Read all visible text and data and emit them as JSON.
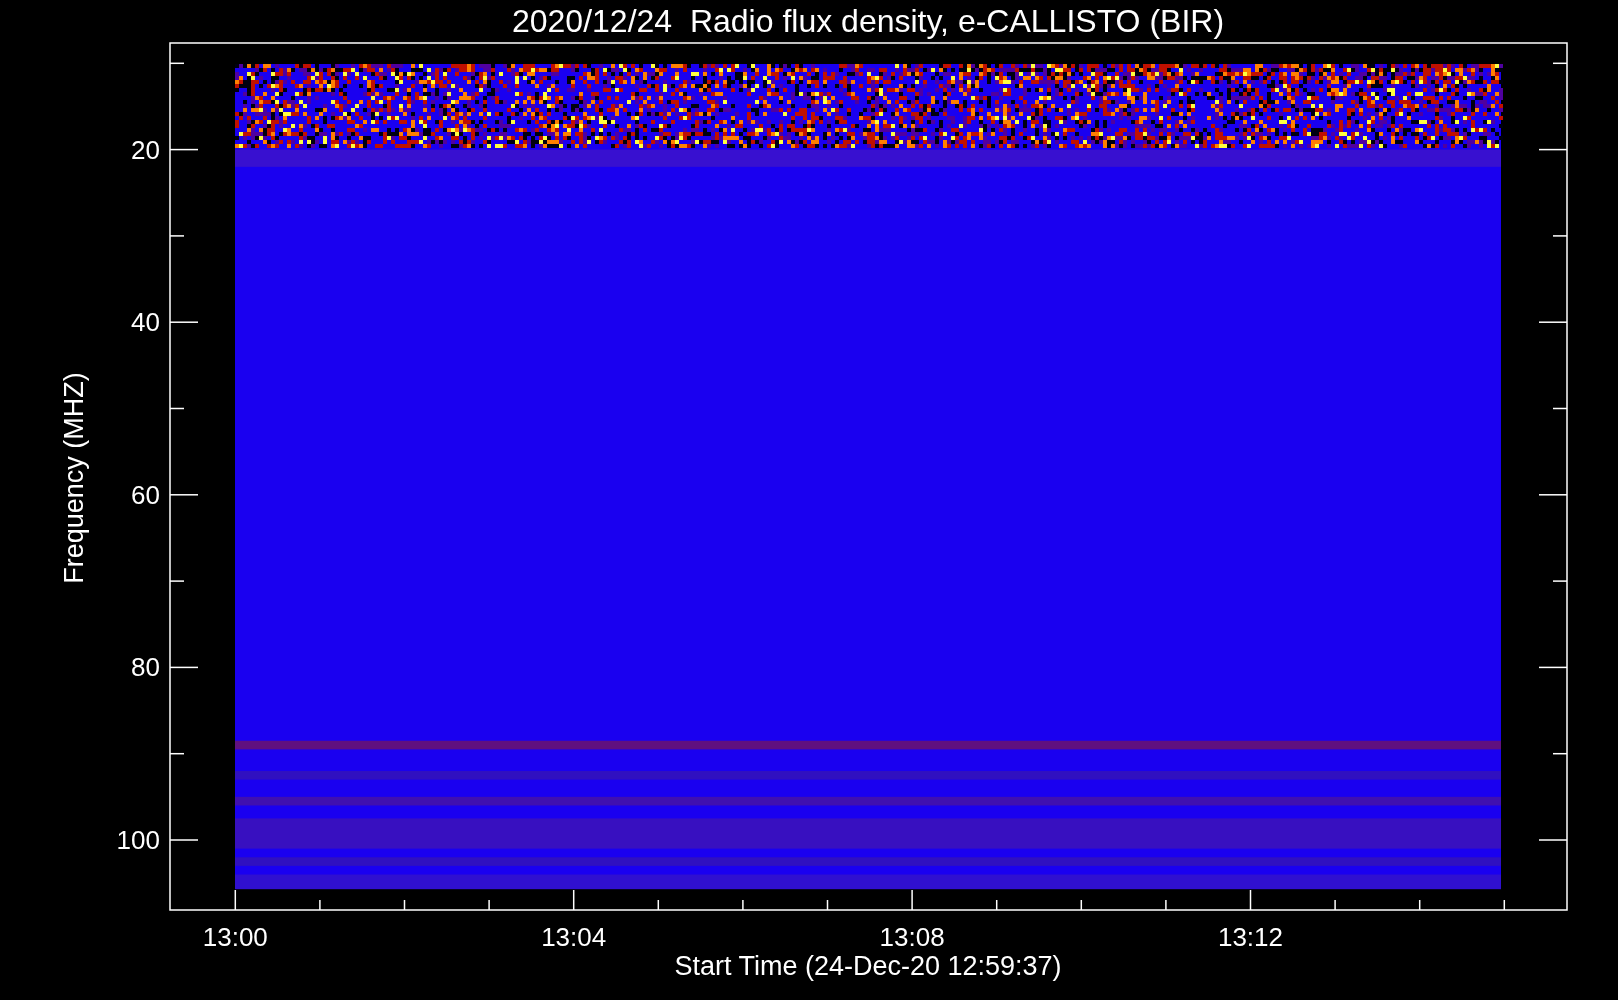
{
  "title": "2020/12/24  Radio flux density, e-CALLISTO (BIR)",
  "plot": {
    "xlabel": "Start Time (24-Dec-20 12:59:37)",
    "ylabel": "Frequency (MHZ)",
    "xtick_labels": [
      "13:00",
      "13:04",
      "13:08",
      "13:12"
    ],
    "ytick_labels": [
      "20",
      "40",
      "60",
      "80",
      "100"
    ]
  }
}
